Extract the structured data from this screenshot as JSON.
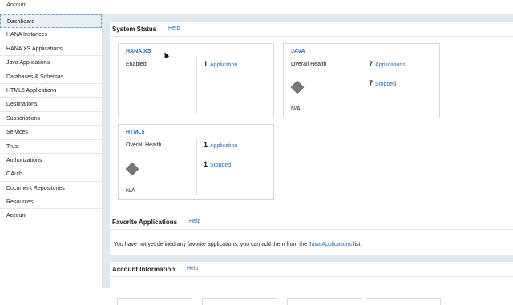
{
  "header": {
    "account_label": "Account"
  },
  "sidebar": {
    "items": [
      {
        "label": "Dashboard"
      },
      {
        "label": "HANA Instances"
      },
      {
        "label": "HANA XS Applications"
      },
      {
        "label": "Java Applications"
      },
      {
        "label": "Databases & Schemas"
      },
      {
        "label": "HTML5 Applications"
      },
      {
        "label": "Destinations"
      },
      {
        "label": "Subscriptions"
      },
      {
        "label": "Services"
      },
      {
        "label": "Trust"
      },
      {
        "label": "Authorizations"
      },
      {
        "label": "OAuth"
      },
      {
        "label": "Document Repositories"
      },
      {
        "label": "Resources"
      },
      {
        "label": "Account"
      }
    ]
  },
  "system_status": {
    "title": "System Status",
    "help": "Help",
    "hana_xs": {
      "title": "HANA XS",
      "status": "Enabled",
      "count": "1",
      "count_label": "Application"
    },
    "java": {
      "title": "JAVA",
      "health_label": "Overall Health",
      "health_value": "N/A",
      "apps_count": "7",
      "apps_label": "Applications",
      "stopped_count": "7",
      "stopped_label": "Stopped"
    },
    "html5": {
      "title": "HTML5",
      "health_label": "Overall Health",
      "health_value": "N/A",
      "apps_count": "1",
      "apps_label": "Application",
      "stopped_count": "1",
      "stopped_label": "Stopped"
    }
  },
  "favorites": {
    "title": "Favorite Applications",
    "help": "Help",
    "message_pre": "You have not yet defined any favorite applications; you can add them from the",
    "message_link": "Java Applications",
    "message_post": "list"
  },
  "account_info": {
    "title": "Account Information",
    "help": "Help"
  },
  "colors": {
    "link": "#2a6ebb",
    "background": "#dfe9ef",
    "health_indicator": "#777777"
  }
}
